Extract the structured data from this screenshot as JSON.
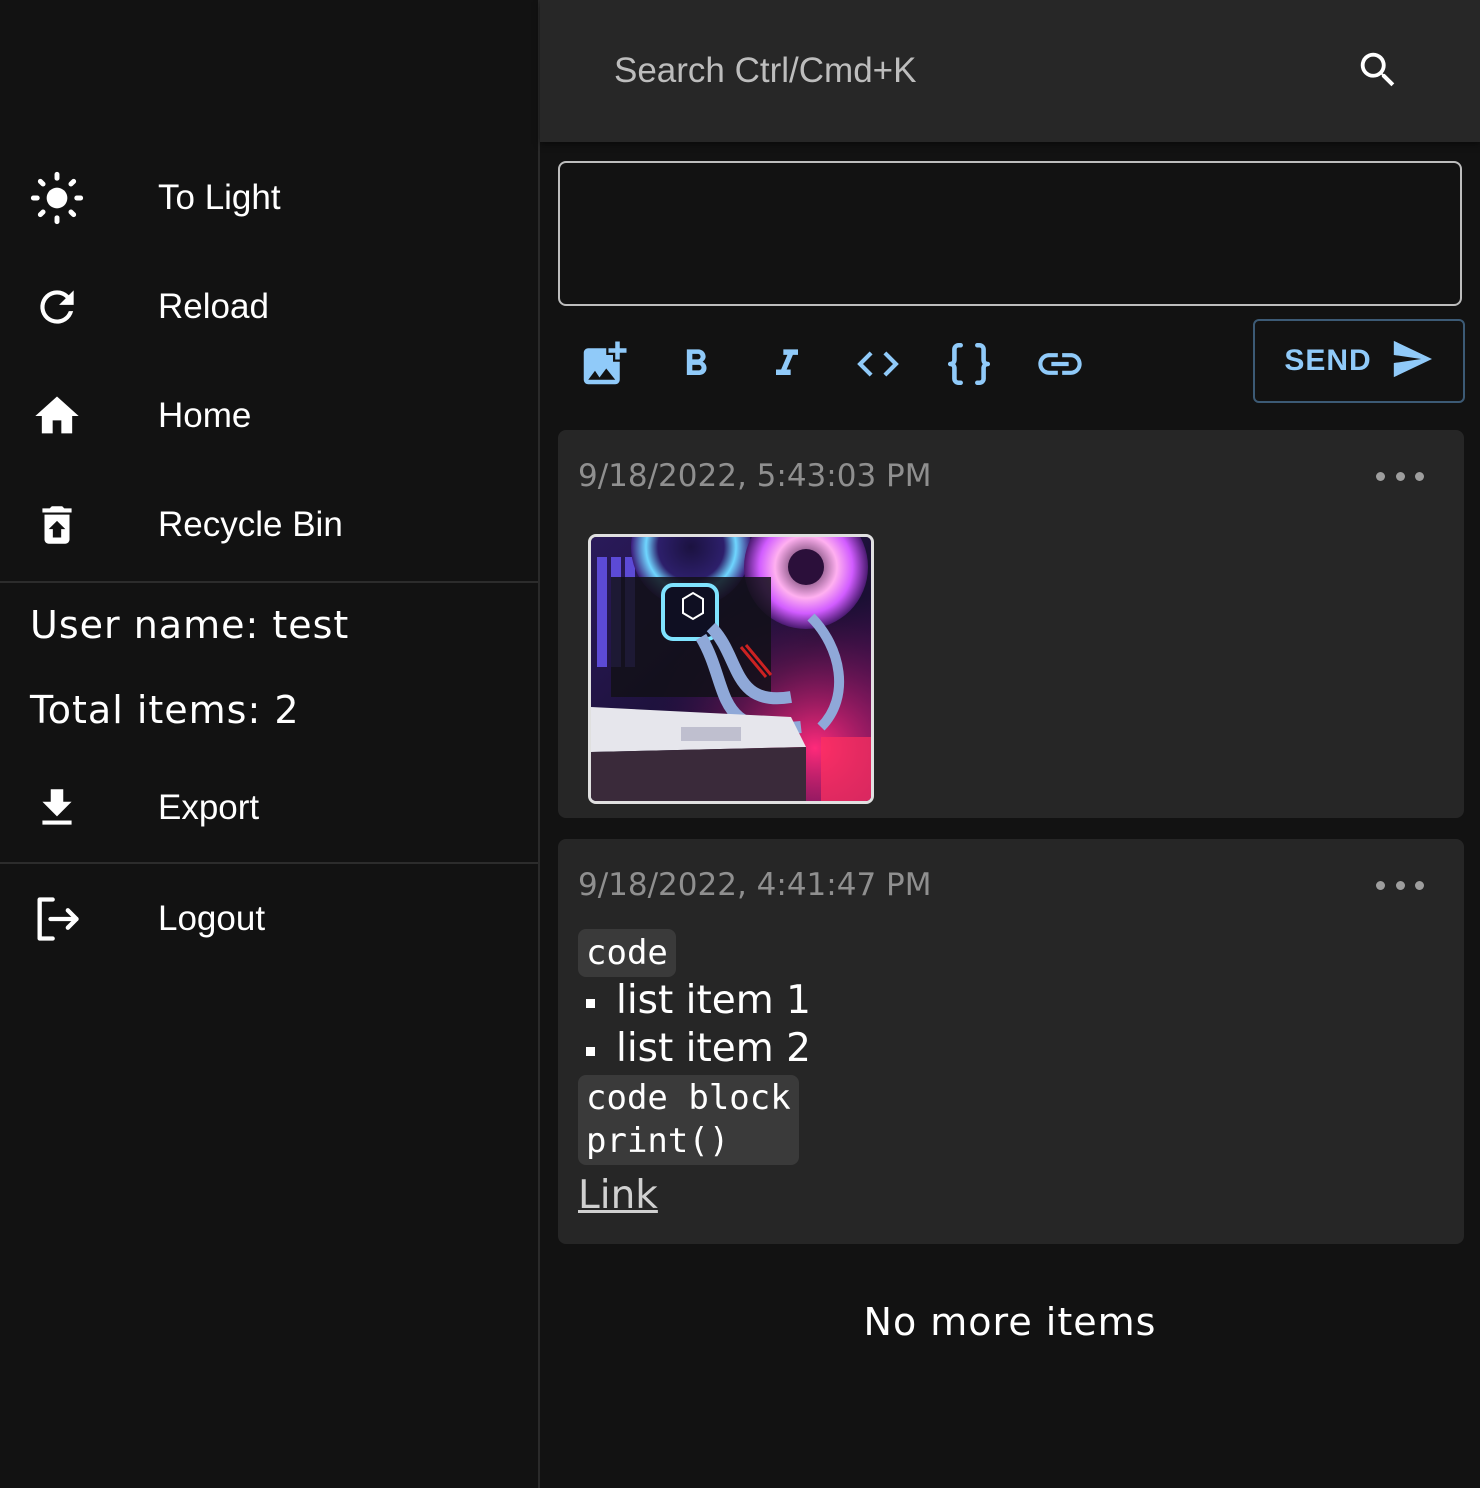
{
  "sidebar": {
    "items": [
      {
        "label": "To Light",
        "icon": "sun-icon"
      },
      {
        "label": "Reload",
        "icon": "reload-icon"
      },
      {
        "label": "Home",
        "icon": "home-icon"
      },
      {
        "label": "Recycle Bin",
        "icon": "recycle-bin-icon"
      }
    ],
    "user_name_label": "User name: ",
    "user_name": "test",
    "total_items_label": "Total items: ",
    "total_items": "2",
    "export_label": "Export",
    "logout_label": "Logout"
  },
  "search": {
    "placeholder": "Search Ctrl/Cmd+K",
    "value": ""
  },
  "editor": {
    "value": "",
    "send_label": "SEND",
    "tools": [
      "add-image-icon",
      "bold-icon",
      "italic-icon",
      "code-icon",
      "code-block-icon",
      "link-icon"
    ]
  },
  "items": [
    {
      "timestamp": "9/18/2022, 5:43:03 PM",
      "type": "image"
    },
    {
      "timestamp": "9/18/2022, 4:41:47 PM",
      "type": "text",
      "inline_code": "code",
      "list": [
        "list item 1",
        "list item 2"
      ],
      "code_block": "code block\nprint()",
      "link": "Link"
    }
  ],
  "footer": {
    "no_more": "No more items"
  },
  "colors": {
    "accent": "#90caf9",
    "background": "#121212",
    "card": "#262626",
    "topbar": "#272727"
  }
}
